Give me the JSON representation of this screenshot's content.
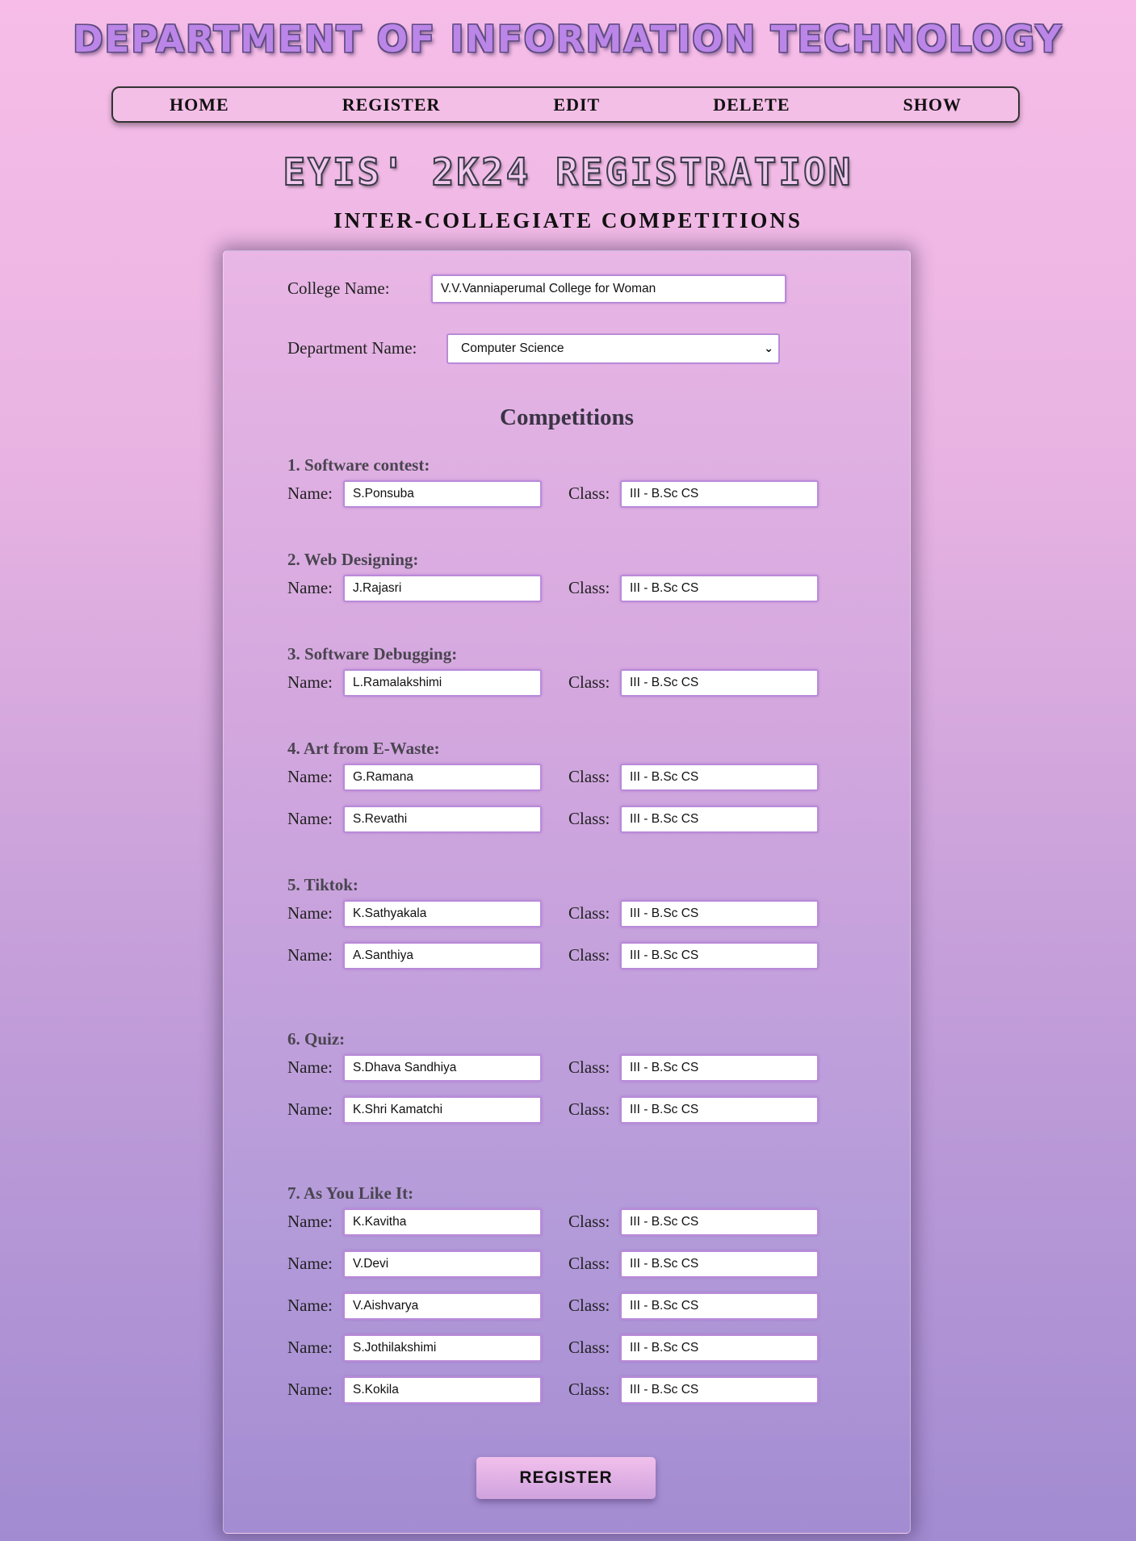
{
  "header": {
    "department_title": "DEPARTMENT OF INFORMATION TECHNOLOGY",
    "event_title": "EYIS' 2K24 REGISTRATION",
    "subtitle": "INTER-COLLEGIATE COMPETITIONS"
  },
  "nav": {
    "items": [
      {
        "label": "HOME"
      },
      {
        "label": "REGISTER"
      },
      {
        "label": "EDIT"
      },
      {
        "label": "DELETE"
      },
      {
        "label": "SHOW"
      }
    ]
  },
  "form": {
    "college_label": "College Name:",
    "college_value": "V.V.Vanniaperumal College for Woman",
    "department_label": "Department Name:",
    "department_value": "Computer Science",
    "competitions_heading": "Competitions",
    "name_label": "Name:",
    "class_label": "Class:",
    "register_button": "REGISTER",
    "sections": [
      {
        "title": "1. Software contest:",
        "participants": [
          {
            "name": "S.Ponsuba",
            "class": "III - B.Sc CS"
          }
        ]
      },
      {
        "title": "2. Web Designing:",
        "participants": [
          {
            "name": "J.Rajasri",
            "class": "III - B.Sc CS"
          }
        ]
      },
      {
        "title": "3. Software Debugging:",
        "participants": [
          {
            "name": "L.Ramalakshimi",
            "class": "III - B.Sc CS"
          }
        ]
      },
      {
        "title": "4. Art from E-Waste:",
        "participants": [
          {
            "name": "G.Ramana",
            "class": "III - B.Sc CS"
          },
          {
            "name": "S.Revathi",
            "class": "III - B.Sc CS"
          }
        ]
      },
      {
        "title": "5. Tiktok:",
        "participants": [
          {
            "name": "K.Sathyakala",
            "class": "III - B.Sc CS"
          },
          {
            "name": "A.Santhiya",
            "class": "III - B.Sc CS"
          }
        ]
      },
      {
        "title": "6. Quiz:",
        "participants": [
          {
            "name": "S.Dhava Sandhiya",
            "class": "III - B.Sc CS"
          },
          {
            "name": "K.Shri Kamatchi",
            "class": "III - B.Sc CS"
          }
        ]
      },
      {
        "title": "7. As You Like It:",
        "participants": [
          {
            "name": "K.Kavitha",
            "class": "III - B.Sc CS"
          },
          {
            "name": "V.Devi",
            "class": "III - B.Sc CS"
          },
          {
            "name": "V.Aishvarya",
            "class": "III - B.Sc CS"
          },
          {
            "name": "S.Jothilakshimi",
            "class": "III - B.Sc CS"
          },
          {
            "name": "S.Kokila",
            "class": "III - B.Sc CS"
          }
        ]
      }
    ]
  }
}
